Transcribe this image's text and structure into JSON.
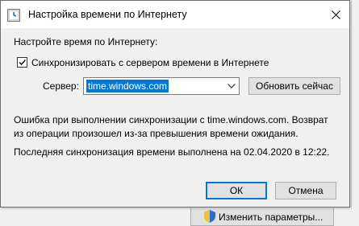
{
  "window": {
    "title": "Настройка времени по Интернету"
  },
  "dialog": {
    "heading": "Настройте время по Интернету:",
    "sync_checkbox": {
      "label": "Синхронизировать с сервером времени в Интернете",
      "checked": true
    },
    "server": {
      "label": "Сервер:",
      "value": "time.windows.com"
    },
    "update_button": "Обновить сейчас",
    "error_message": "Ошибка при выполнении синхронизации с time.windows.com.  Возврат из операции произошел из-за превышения времени ожидания.",
    "last_sync": "Последняя синхронизация времени выполнена на 02.04.2020 в 12:22.",
    "ok_button": "ОК",
    "cancel_button": "Отмена"
  },
  "background": {
    "change_settings_button": "Изменить параметры..."
  },
  "colors": {
    "selection": "#0078d7",
    "dialog_bg": "#f0f0f0",
    "titlebar_bg": "#ffffff",
    "button_bg": "#e1e1e1"
  }
}
